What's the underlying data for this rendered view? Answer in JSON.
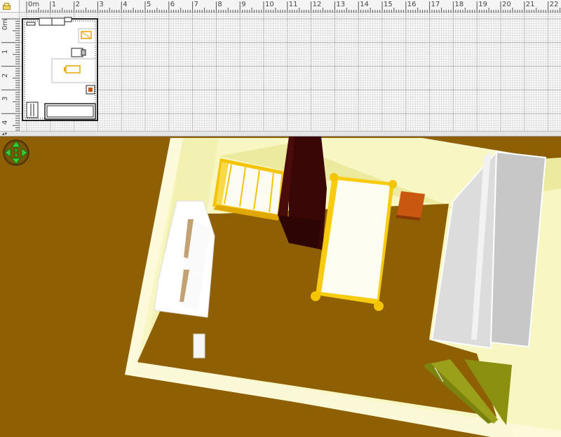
{
  "plan": {
    "x_ruler": [
      "0m",
      "1",
      "2",
      "3",
      "4",
      "5",
      "6",
      "7",
      "8",
      "9",
      "10",
      "11",
      "12",
      "13",
      "14",
      "15",
      "16",
      "17",
      "18",
      "19",
      "20",
      "21",
      "22"
    ],
    "y_ruler": [
      "0m",
      "1",
      "2",
      "3",
      "4"
    ],
    "furniture": [
      "crib",
      "bed",
      "nightstand",
      "wardrobe",
      "bookshelf",
      "radiator",
      "door"
    ]
  },
  "view3d": {
    "navigation": [
      "move-up",
      "move-down",
      "move-left",
      "move-right"
    ],
    "colors": {
      "floor": "#8f5f04",
      "wall": "#f8f6c2",
      "wall_shade": "#ecea9f",
      "crib": "#f5c400",
      "bed_frame": "#fce66e",
      "mattress": "#fdfdf2",
      "wardrobe": "#360806",
      "nightstand": "#c9570f",
      "closet": "#dedede",
      "door": "#9aa01a"
    }
  }
}
